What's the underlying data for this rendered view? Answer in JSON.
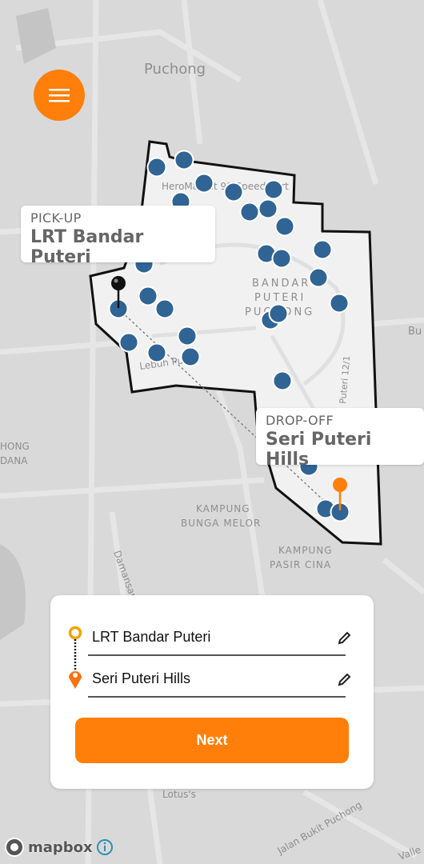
{
  "map": {
    "labels": {
      "puchong": "Puchong",
      "heromarket": "HeroMarket 99 Speedmart",
      "bandar1": "BANDAR",
      "bandar2": "PUTERI",
      "bandar3": "PUCHONG",
      "lebuh": "Lebuh Puteri",
      "puteri121": "Puteri 12/1",
      "bunga1": "KAMPUNG",
      "bunga2": "BUNGA MELOR",
      "pasir1": "KAMPUNG",
      "pasir2": "PASIR CINA",
      "puchongdana1": "HONG",
      "puchongdana2": "DANA",
      "damansara": "Damansara",
      "lotus": "Lotus's",
      "bukit": "Jalan Bukit Puchong",
      "bu": "Bu",
      "valley": "Valle"
    },
    "zone_dot_color": "#2f6494",
    "zone_border_color": "#111111"
  },
  "menu": {
    "icon": "hamburger-icon",
    "color": "#ff7f0a"
  },
  "pickup": {
    "label": "PICK-UP",
    "name": "LRT Bandar Puteri"
  },
  "dropoff": {
    "label": "DROP-OFF",
    "name": "Seri Puteri Hills"
  },
  "form": {
    "origin": "LRT Bandar Puteri",
    "destination": "Seri Puteri Hills",
    "next_label": "Next",
    "accent": "#ff7f0a",
    "origin_color": "#f0a500"
  },
  "attribution": {
    "brand": "mapbox",
    "info_icon": "info-icon"
  }
}
